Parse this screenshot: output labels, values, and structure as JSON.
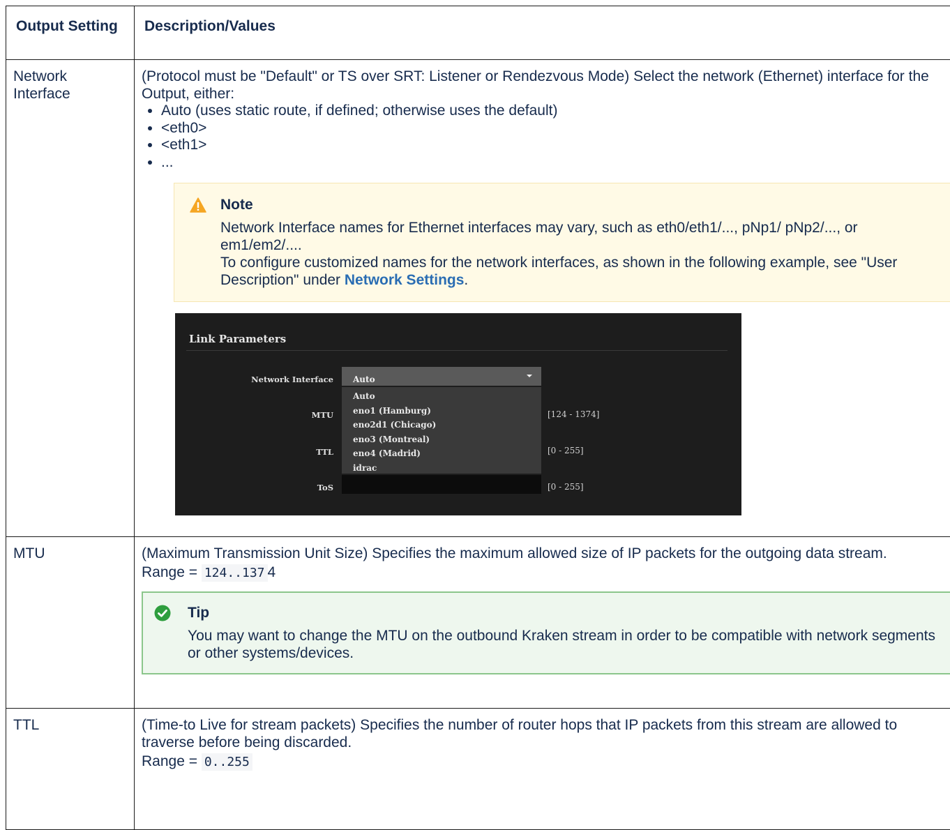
{
  "header": {
    "col1": "Output Setting",
    "col2": "Description/Values"
  },
  "rows": {
    "network_interface": {
      "label": "Network Interface",
      "description": "(Protocol must be \"Default\" or TS over SRT: Listener or Rendezvous Mode) Select the network (Ethernet) interface for the Output, either:",
      "options": [
        "Auto (uses static route, if defined; otherwise uses the default)",
        "<eth0>",
        "<eth1>",
        "..."
      ],
      "note": {
        "title": "Note",
        "line1": "Network Interface names for Ethernet interfaces may vary, such as eth0/eth1/..., pNp1/ pNp2/..., or em1/em2/....",
        "line2_prefix": "To configure customized names for the network interfaces, as shown in the following example, see \"User Description\" under ",
        "link": "Network Settings",
        "line2_suffix": "."
      },
      "screenshot": {
        "title": "Link Parameters",
        "network_interface_label": "Network Interface",
        "selected": "Auto",
        "menu_options": [
          "Auto",
          "eno1 (Hamburg)",
          "eno2d1 (Chicago)",
          "eno3 (Montreal)",
          "eno4 (Madrid)",
          "idrac"
        ],
        "mtu_label": "MTU",
        "mtu_range": "[124 - 1374]",
        "ttl_label": "TTL",
        "ttl_range": "[0 - 255]",
        "tos_label": "ToS",
        "tos_range": "[0 - 255]"
      }
    },
    "mtu": {
      "label": "MTU",
      "description": "(Maximum Transmission Unit Size) Specifies the maximum allowed size of IP packets for the outgoing data stream.",
      "range_prefix": "Range = ",
      "range_code": "124..137",
      "range_suffix": "4",
      "tip": {
        "title": "Tip",
        "body": "You may want to change the MTU on the outbound Kraken stream in order to be compatible with network segments or other systems/devices."
      }
    },
    "ttl": {
      "label": "TTL",
      "description": "(Time-to Live for stream packets) Specifies the number of router hops that IP packets from this stream are allowed to traverse before being discarded.",
      "range_prefix": "Range = ",
      "range_code": "0..255"
    }
  },
  "colors": {
    "link": "#2a6db3",
    "note_bg": "#fffae6",
    "tip_bg": "#eef7ee",
    "tip_border": "#8bc68b",
    "warn_icon": "#f5a623",
    "check_icon": "#2e9e3e"
  },
  "icons": {
    "note": "warning-icon",
    "tip": "check-circle-icon"
  }
}
